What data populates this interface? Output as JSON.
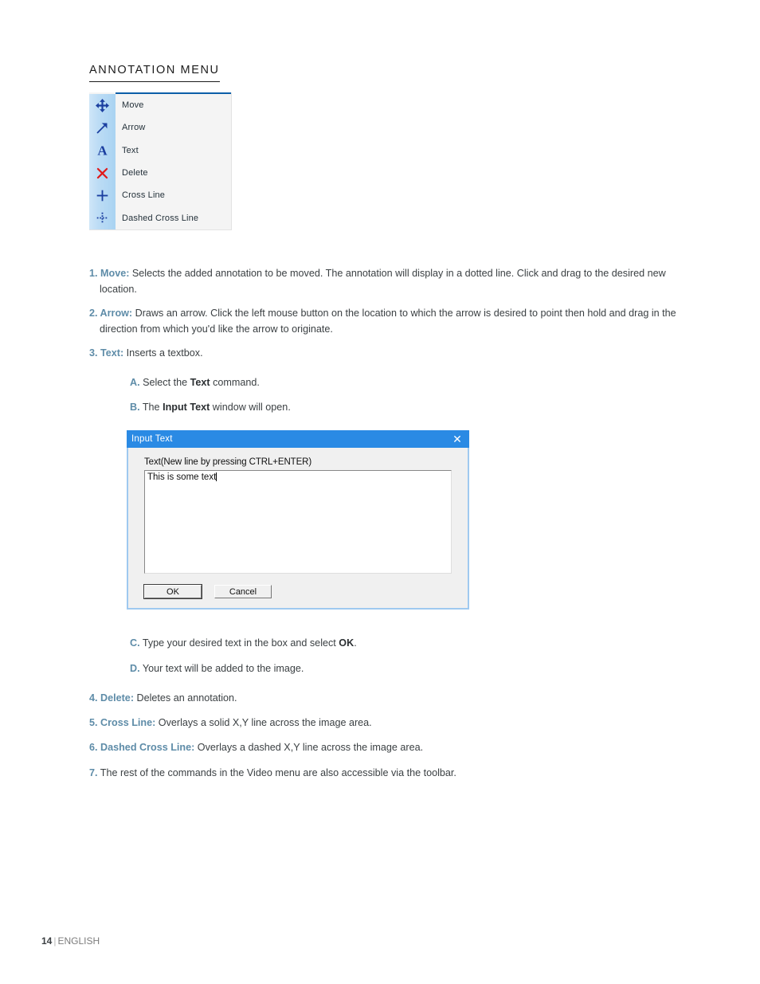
{
  "heading": "ANNOTATION MENU",
  "menu": {
    "items": [
      {
        "icon": "move-icon",
        "label": "Move"
      },
      {
        "icon": "arrow-icon",
        "label": "Arrow"
      },
      {
        "icon": "text-icon",
        "label": "Text"
      },
      {
        "icon": "delete-icon",
        "label": "Delete"
      },
      {
        "icon": "cross-line-icon",
        "label": "Cross Line"
      },
      {
        "icon": "dashed-cross-line-icon",
        "label": "Dashed Cross Line"
      }
    ]
  },
  "items": {
    "i1": {
      "num": "1. ",
      "lead": "Move:",
      "text": " Selects the added annotation to be moved. The annotation will display in a dotted line. Click and drag to the desired new location."
    },
    "i2": {
      "num": "2. ",
      "lead": "Arrow:",
      "text": " Draws an arrow. Click the left mouse button on the location to which the arrow is desired to point then hold and drag in the direction from which you'd like the arrow to originate."
    },
    "i3": {
      "num": "3. ",
      "lead": "Text:",
      "text": " Inserts a textbox."
    },
    "i4": {
      "num": "4. ",
      "lead": "Delete:",
      "text": " Deletes an annotation."
    },
    "i5": {
      "num": "5. ",
      "lead": "Cross Line:",
      "text": " Overlays a solid X,Y line across the image area."
    },
    "i6": {
      "num": "6. ",
      "lead": "Dashed Cross Line:",
      "text": " Overlays a dashed X,Y line across the image area."
    },
    "i7": {
      "num": "7.",
      "lead": "",
      "text": " The rest of the commands in the Video menu are also accessible via the toolbar."
    }
  },
  "sub": {
    "a": {
      "alpha": "A.",
      "pre": " Select the ",
      "bold": "Text",
      "post": " command."
    },
    "b": {
      "alpha": "B.",
      "pre": " The ",
      "bold": "Input Text",
      "post": " window will open."
    },
    "c": {
      "alpha": "C.",
      "pre": " Type your desired text in the box and select ",
      "bold": "OK",
      "post": "."
    },
    "d": {
      "alpha": "D.",
      "pre": " Your text will be added to the image.",
      "bold": "",
      "post": ""
    }
  },
  "dialog": {
    "title": "Input Text",
    "close_glyph": "✕",
    "field_label": "Text(New line by pressing CTRL+ENTER)",
    "textarea_value": "This is some text",
    "ok_label": "OK",
    "cancel_label": "Cancel"
  },
  "footer": {
    "page": "14",
    "separator": "|",
    "language": "ENGLISH"
  },
  "colors": {
    "accent_blue": "#5e8ca8",
    "menu_rule": "#0b5ea8",
    "titlebar": "#2a8ae4",
    "icon_blue": "#1b3fa0",
    "icon_red": "#e01b1b"
  }
}
